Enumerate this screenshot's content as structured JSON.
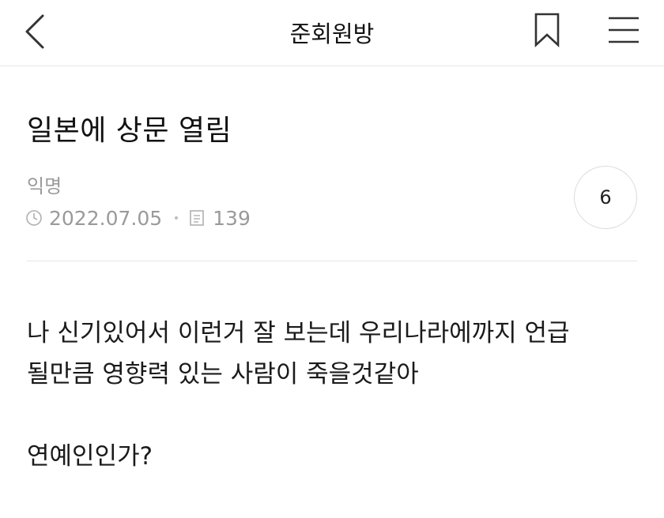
{
  "header": {
    "title": "준회원방",
    "back_icon": "chevron-left-icon",
    "bookmark_icon": "bookmark-icon",
    "menu_icon": "hamburger-menu-icon"
  },
  "post": {
    "title": "일본에 상문 열림",
    "author": "익명",
    "date": "2022.07.05",
    "views": "139",
    "comment_count": "6",
    "body_lines": [
      "나 신기있어서 이런거 잘 보는데 우리나라에까지 언급",
      "될만큼 영향력 있는 사람이 죽을것같아"
    ],
    "body_question": "연예인인가?"
  },
  "colors": {
    "text": "#1a1a1a",
    "muted": "#9a9a9a",
    "divider": "#e6e6e6"
  }
}
